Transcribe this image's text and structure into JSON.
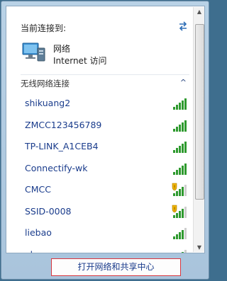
{
  "header": {
    "label": "当前连接到:",
    "refresh_icon": "refresh-icon"
  },
  "current_network": {
    "name": "网络",
    "status": "Internet 访问",
    "icon": "network-icon"
  },
  "section": {
    "title": "无线网络连接",
    "chevron": "^"
  },
  "networks": [
    {
      "ssid": "shikuang2",
      "security": "secured",
      "signal": 5
    },
    {
      "ssid": "ZMCC123456789",
      "security": "secured",
      "signal": 5
    },
    {
      "ssid": "TP-LINK_A1CEB4",
      "security": "secured",
      "signal": 5
    },
    {
      "ssid": "Connectify-wk",
      "security": "secured",
      "signal": 5
    },
    {
      "ssid": "CMCC",
      "security": "open-warning",
      "signal": 4
    },
    {
      "ssid": "SSID-0008",
      "security": "open-warning",
      "signal": 4
    },
    {
      "ssid": "liebao",
      "security": "secured",
      "signal": 4
    },
    {
      "ssid": "abc",
      "security": "secured",
      "signal": 4
    }
  ],
  "footer": {
    "open_center_label": "打开网络和共享中心"
  },
  "colors": {
    "link": "#1a3c8c",
    "signal_green": "#2f9a2f",
    "highlight_border": "#d9363e"
  }
}
